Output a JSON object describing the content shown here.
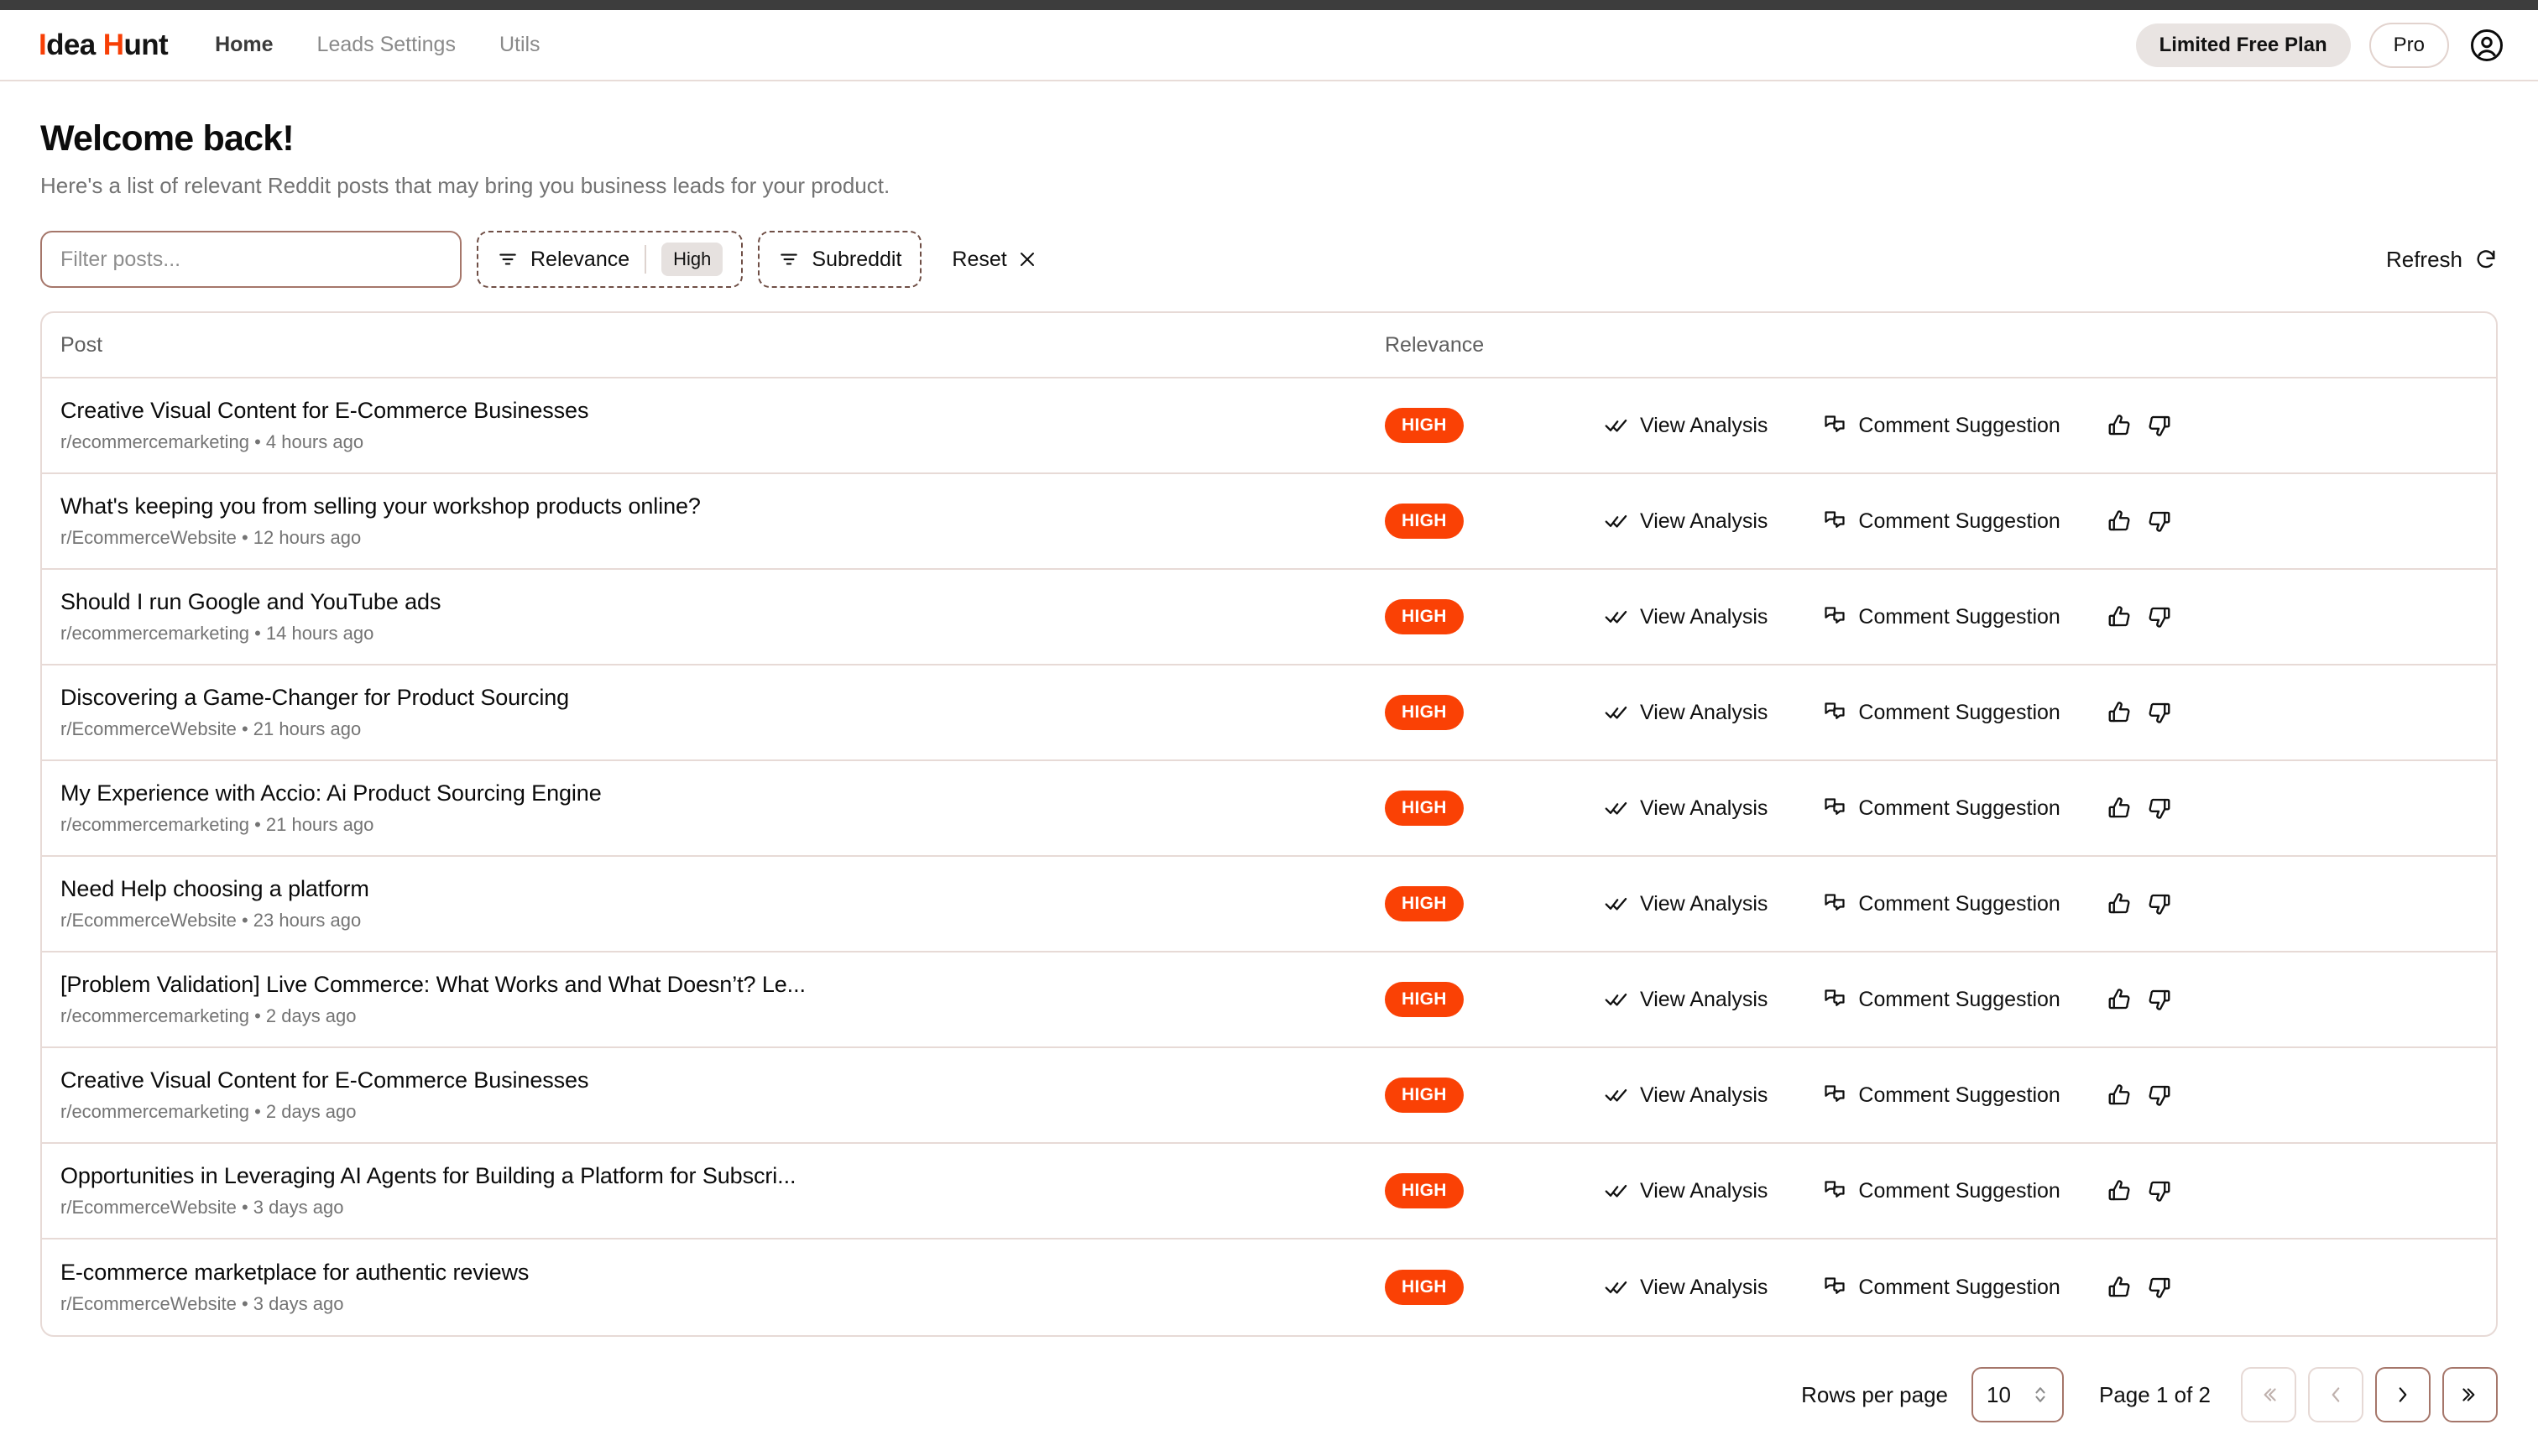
{
  "brand": {
    "accent1": "I",
    "rest1": "dea",
    "accent2": "H",
    "rest2": "unt",
    "accent_color": "#f73f06"
  },
  "nav": {
    "links": [
      {
        "label": "Home",
        "active": true
      },
      {
        "label": "Leads Settings",
        "active": false
      },
      {
        "label": "Utils",
        "active": false
      }
    ],
    "plan_badge": "Limited Free Plan",
    "pro_button": "Pro"
  },
  "header": {
    "title": "Welcome back!",
    "subtitle": "Here's a list of relevant Reddit posts that may bring you business leads for your product."
  },
  "filters": {
    "search_placeholder": "Filter posts...",
    "search_value": "",
    "relevance_label": "Relevance",
    "relevance_value": "High",
    "subreddit_label": "Subreddit",
    "reset_label": "Reset",
    "refresh_label": "Refresh"
  },
  "table": {
    "columns": {
      "post": "Post",
      "relevance": "Relevance"
    },
    "actions": {
      "view_analysis": "View Analysis",
      "comment_suggestion": "Comment Suggestion"
    },
    "badge_color": "#fa4105",
    "rows": [
      {
        "title": "Creative Visual Content for E-Commerce Businesses",
        "meta": "r/ecommercemarketing • 4 hours ago",
        "relevance": "HIGH"
      },
      {
        "title": "What's keeping you from selling your workshop products online?",
        "meta": "r/EcommerceWebsite • 12 hours ago",
        "relevance": "HIGH"
      },
      {
        "title": "Should I run Google and YouTube ads",
        "meta": "r/ecommercemarketing • 14 hours ago",
        "relevance": "HIGH"
      },
      {
        "title": "Discovering a Game-Changer for Product Sourcing",
        "meta": "r/EcommerceWebsite • 21 hours ago",
        "relevance": "HIGH"
      },
      {
        "title": "My Experience with Accio: Ai Product Sourcing Engine",
        "meta": "r/ecommercemarketing • 21 hours ago",
        "relevance": "HIGH"
      },
      {
        "title": "Need Help choosing a platform",
        "meta": "r/EcommerceWebsite • 23 hours ago",
        "relevance": "HIGH"
      },
      {
        "title": "[Problem Validation] Live Commerce: What Works and What Doesn’t? Le...",
        "meta": "r/ecommercemarketing • 2 days ago",
        "relevance": "HIGH"
      },
      {
        "title": "Creative Visual Content for E-Commerce Businesses",
        "meta": "r/ecommercemarketing • 2 days ago",
        "relevance": "HIGH"
      },
      {
        "title": "Opportunities in Leveraging AI Agents for Building a Platform for Subscri...",
        "meta": "r/EcommerceWebsite • 3 days ago",
        "relevance": "HIGH"
      },
      {
        "title": "E-commerce marketplace for authentic reviews",
        "meta": "r/EcommerceWebsite • 3 days ago",
        "relevance": "HIGH"
      }
    ]
  },
  "pagination": {
    "rows_per_page_label": "Rows per page",
    "rows_per_page_value": "10",
    "page_status": "Page 1 of 2"
  }
}
